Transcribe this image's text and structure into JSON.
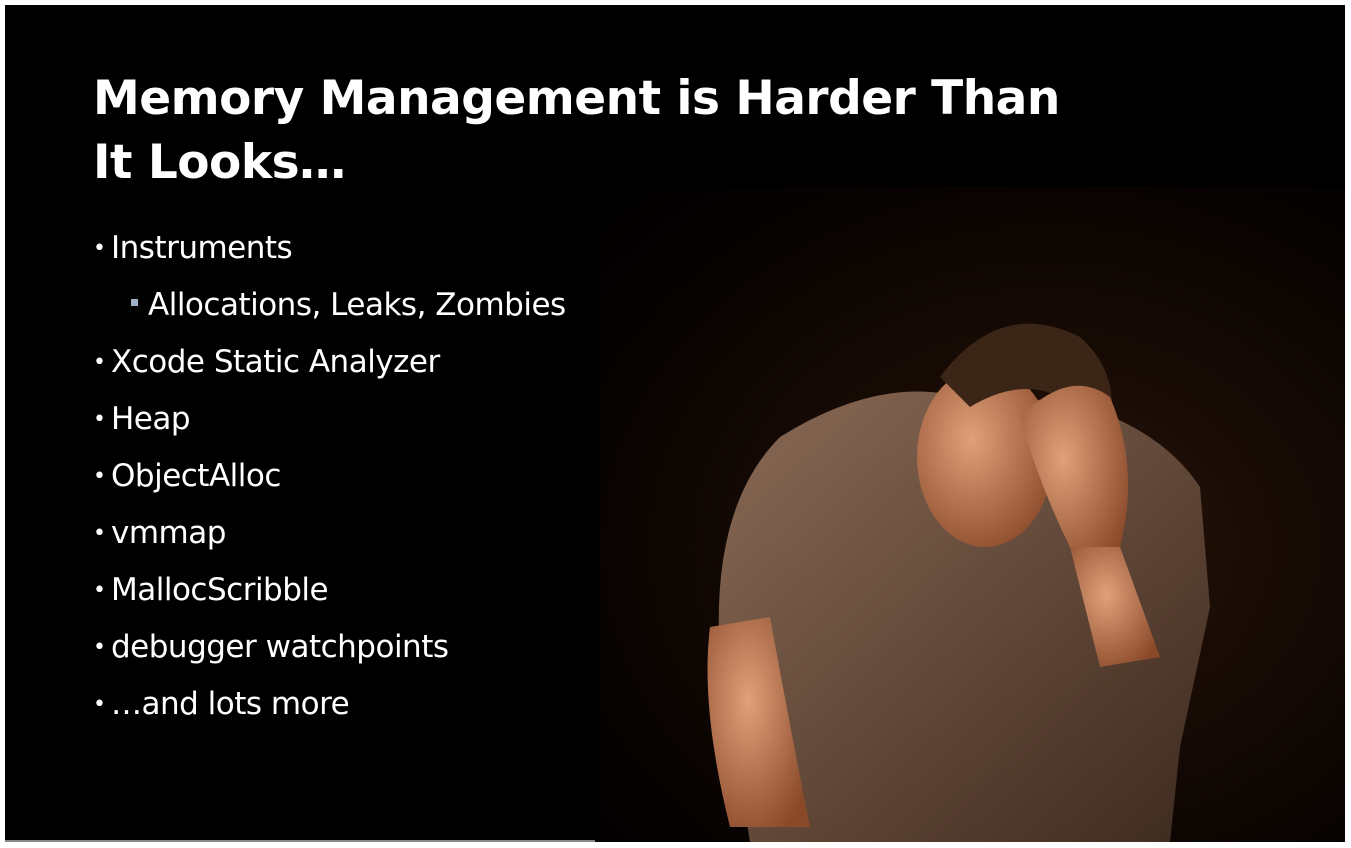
{
  "slide": {
    "title_line1": "Memory Management is Harder Than",
    "title_line2": "It Looks…",
    "bullets": [
      {
        "text": "Instruments",
        "level": 1
      },
      {
        "text": "Allocations, Leaks, Zombies",
        "level": 2
      },
      {
        "text": "Xcode Static Analyzer",
        "level": 1
      },
      {
        "text": "Heap",
        "level": 1
      },
      {
        "text": "ObjectAlloc",
        "level": 1
      },
      {
        "text": "vmmap",
        "level": 1
      },
      {
        "text": "MallocScribble",
        "level": 1
      },
      {
        "text": "debugger watchpoints",
        "level": 1
      },
      {
        "text": "…and lots more",
        "level": 1
      }
    ],
    "bullet_glyph": "•",
    "colors": {
      "background": "#000000",
      "text": "#ffffff",
      "sub_bullet": "#9fb0c6"
    }
  }
}
